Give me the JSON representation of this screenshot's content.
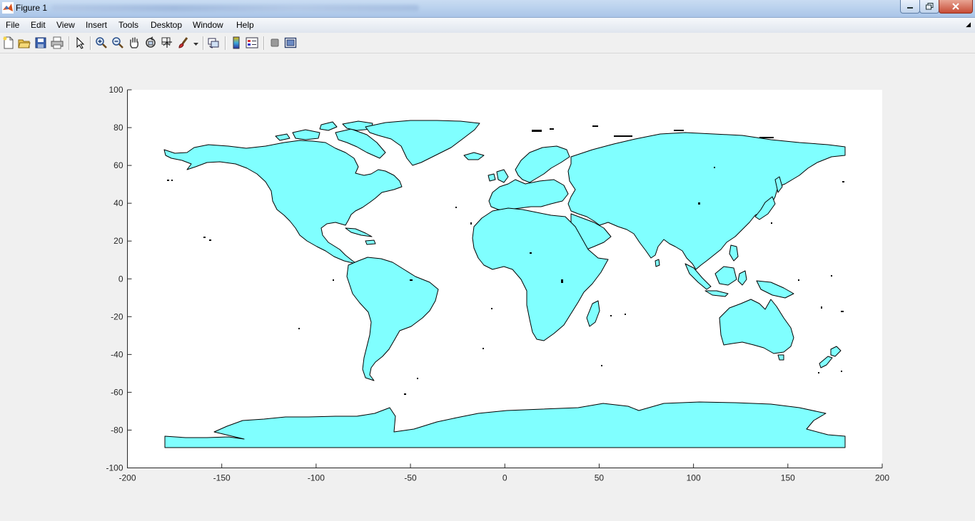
{
  "window": {
    "title": "Figure 1",
    "title_suffix_redacted": true
  },
  "menu": {
    "items": [
      {
        "name": "file",
        "label": "File"
      },
      {
        "name": "edit",
        "label": "Edit"
      },
      {
        "name": "view",
        "label": "View"
      },
      {
        "name": "insert",
        "label": "Insert"
      },
      {
        "name": "tools",
        "label": "Tools"
      },
      {
        "name": "desktop",
        "label": "Desktop"
      },
      {
        "name": "window",
        "label": "Window"
      },
      {
        "name": "help",
        "label": "Help"
      }
    ]
  },
  "toolbar": {
    "icons": [
      "new-figure-icon",
      "open-file-icon",
      "save-icon",
      "print-icon",
      "edit-plot-arrow-icon",
      "zoom-in-icon",
      "zoom-out-icon",
      "pan-hand-icon",
      "rotate-3d-icon",
      "data-cursor-icon",
      "brush-icon",
      "brush-dropdown-icon",
      "link-plot-icon",
      "insert-colorbar-icon",
      "insert-legend-icon",
      "hide-plot-tools-icon",
      "show-plot-tools-icon"
    ]
  },
  "colors": {
    "land_fill": "#80ffff",
    "coast_stroke": "#000000",
    "axes_bg": "#ffffff",
    "figure_bg": "#f0f0f0"
  },
  "plot": {
    "xlim": [
      -200,
      200
    ],
    "ylim": [
      -100,
      100
    ],
    "xticks": [
      -200,
      -150,
      -100,
      -50,
      0,
      50,
      100,
      150,
      200
    ],
    "yticks": [
      100,
      80,
      60,
      40,
      20,
      0,
      -20,
      -40,
      -60,
      -80,
      -100
    ],
    "content": "world coastlines map (longitude vs latitude) with filled landmasses"
  }
}
